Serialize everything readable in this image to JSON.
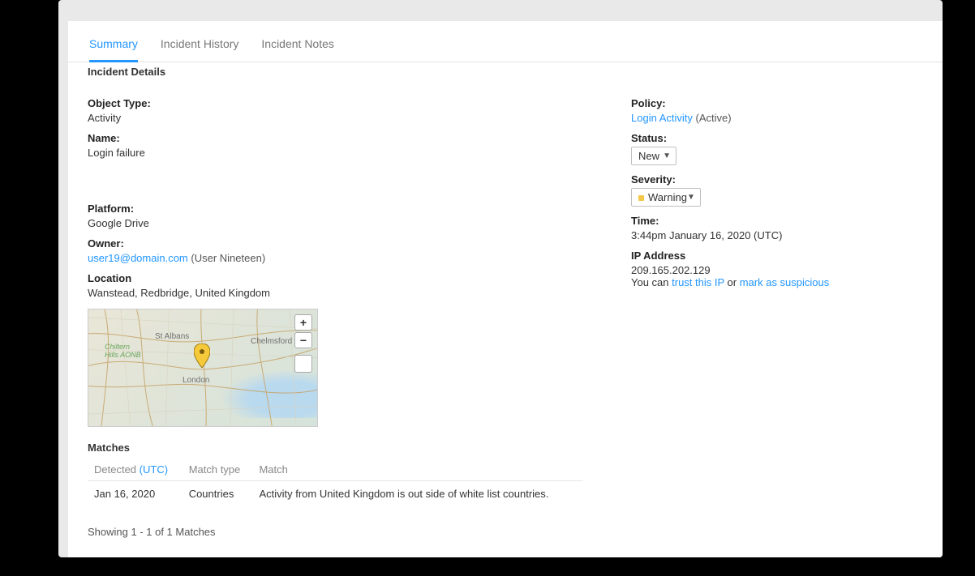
{
  "tabs": [
    "Summary",
    "Incident History",
    "Incident Notes"
  ],
  "section": {
    "title": "Incident Details"
  },
  "left": {
    "objectType": {
      "label": "Object Type:",
      "value": "Activity"
    },
    "name": {
      "label": "Name:",
      "value": "Login failure"
    },
    "platform": {
      "label": "Platform:",
      "value": "Google Drive"
    },
    "owner": {
      "label": "Owner:",
      "email": "user19@domain.com",
      "display": " (User Nineteen)"
    },
    "location": {
      "label": "Location",
      "value": "Wanstead, Redbridge, United Kingdom"
    }
  },
  "map": {
    "labels": {
      "london": "London",
      "chelmsford": "Chelmsford",
      "stalbans": "St Albans",
      "park": "Chiltern Hills AONB"
    },
    "controls": {
      "zoomIn": "+",
      "zoomOut": "−"
    }
  },
  "matches": {
    "title": "Matches",
    "columns": [
      {
        "label": "Detected ",
        "tz": "(UTC)"
      },
      {
        "label": "Match type"
      },
      {
        "label": "Match"
      }
    ],
    "rows": [
      {
        "detected": "Jan 16, 2020",
        "type": "Countries",
        "desc": "Activity from United Kingdom is out side of white list countries."
      }
    ],
    "showing": "Showing 1 - 1 of 1 Matches"
  },
  "right": {
    "policy": {
      "label": "Policy:",
      "link": "Login Activity",
      "state": " (Active)"
    },
    "status": {
      "label": "Status:",
      "value": "New"
    },
    "severity": {
      "label": "Severity:",
      "value": "Warning"
    },
    "time": {
      "label": "Time:",
      "value": "3:44pm January 16, 2020 (UTC)"
    },
    "ip": {
      "label": "IP Address",
      "value": "209.165.202.129",
      "prefix": "You can ",
      "trust": "trust this IP",
      "or": " or ",
      "suspicious": "mark as suspicious"
    }
  }
}
